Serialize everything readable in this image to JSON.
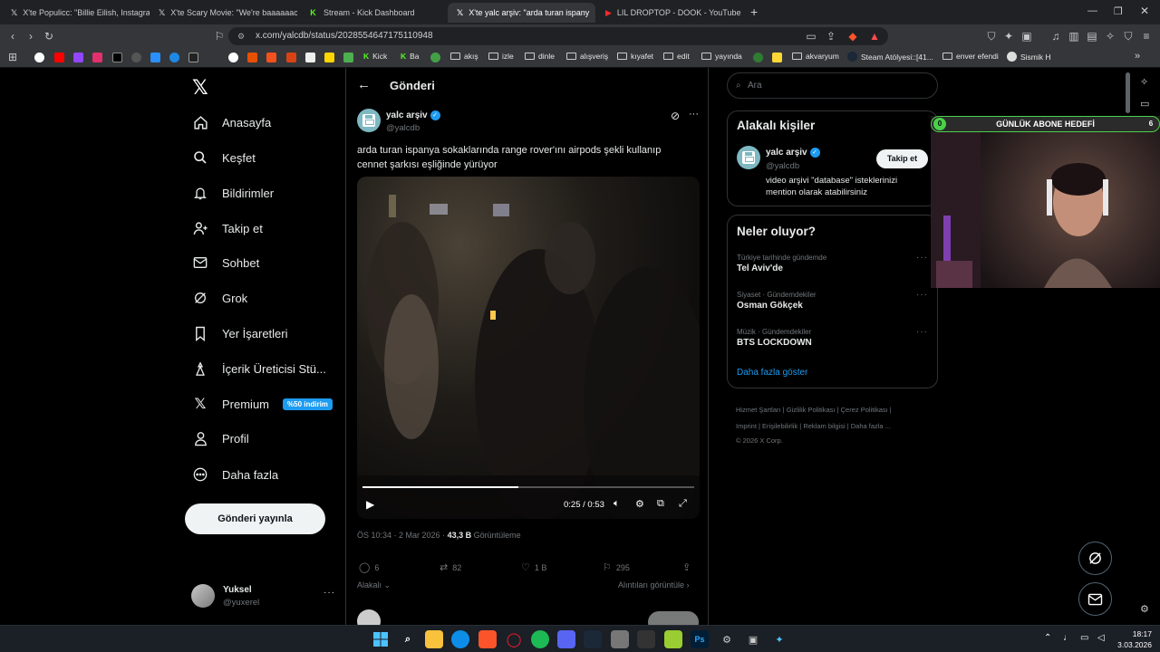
{
  "browser": {
    "tabs": [
      {
        "title": "X'te Populicc: \"Billie Eilish, Instagram'",
        "icon": "x-icon"
      },
      {
        "title": "X'te Scary Movie: \"We're baaaaaack.",
        "icon": "x-icon"
      },
      {
        "title": "Stream - Kick Dashboard",
        "icon": "kick-icon"
      },
      {
        "title": "X'te yalc arşiv: \"arda turan ispany",
        "icon": "x-icon"
      },
      {
        "title": "LIL DROPTOP - DOOK - YouTube",
        "icon": "youtube-icon"
      }
    ],
    "new_tab": "+",
    "url": "x.com/yalcdb/status/2028554647175110948",
    "bookmarks": [
      "Kick",
      "Ba",
      "akış",
      "izle",
      "dinle",
      "alışveriş",
      "kıyafet",
      "edit",
      "yayında",
      "akvaryum",
      "Steam Atölyesi::[41...",
      "enver efendi",
      "Sismik H"
    ]
  },
  "nav": {
    "items": [
      {
        "label": "Anasayfa",
        "icon": "home-icon"
      },
      {
        "label": "Keşfet",
        "icon": "search-icon"
      },
      {
        "label": "Bildirimler",
        "icon": "bell-icon"
      },
      {
        "label": "Takip et",
        "icon": "follow-icon"
      },
      {
        "label": "Sohbet",
        "icon": "mail-icon"
      },
      {
        "label": "Grok",
        "icon": "grok-icon"
      },
      {
        "label": "Yer İşaretleri",
        "icon": "bookmark-icon"
      },
      {
        "label": "İçerik Üreticisi Stü...",
        "icon": "creator-icon"
      },
      {
        "label": "Premium",
        "icon": "x-logo-icon"
      },
      {
        "label": "Profil",
        "icon": "profile-icon"
      },
      {
        "label": "Daha fazla",
        "icon": "more-icon"
      }
    ],
    "premium_badge": "%50 indirim",
    "post_button": "Gönderi yayınla",
    "account": {
      "name": "Yuksel",
      "handle": "@yuxerel"
    }
  },
  "post": {
    "header": "Gönderi",
    "author_name": "yalc arşiv",
    "author_handle": "@yalcdb",
    "text_line1": "arda turan ispanya sokaklarında range rover'ını airpods şekli kullanıp",
    "text_line2": "cennet şarkısı eşliğinde yürüyor",
    "video": {
      "time": "0:25 / 0:53",
      "progress": 0.47
    },
    "meta_time": "ÖS 10:34 · 2 Mar 2026 ·",
    "views_count": "43,3 B",
    "views_label": "Görüntüleme",
    "stats": {
      "replies": "6",
      "reposts": "82",
      "likes": "1 B",
      "bookmarks": "295"
    },
    "related_label": "Alakalı",
    "quotes_label": "Alıntıları görüntüle"
  },
  "sidebar": {
    "search_placeholder": "Ara",
    "people_title": "Alakalı kişiler",
    "person": {
      "name": "yalc arşiv",
      "handle": "@yalcdb",
      "bio": "video arşivi \"database\" isteklerinizi mention olarak atabilirsiniz",
      "follow": "Takip et"
    },
    "trends_title": "Neler oluyor?",
    "trends": [
      {
        "category": "Türkiye tarihinde gündemde",
        "name": "Tel Aviv'de"
      },
      {
        "category": "Siyaset · Gündemdekiler",
        "name": "Osman Gökçek"
      },
      {
        "category": "Müzik · Gündemdekiler",
        "name": "BTS LOCKDOWN"
      }
    ],
    "show_more": "Daha fazla göster",
    "footer": {
      "l1": "Hizmet Şartları",
      "l2": "Gizlilik Politikası",
      "l3": "Çerez Politikası",
      "l4": "Imprint",
      "l5": "Erişilebilirlik",
      "l6": "Reklam bilgisi",
      "l7": "Daha fazla ...",
      "copyright": "© 2026 X Corp."
    }
  },
  "overlay": {
    "goal_label": "GÜNLÜK ABONE HEDEFİ",
    "goal_current": "0",
    "goal_target": "6"
  },
  "taskbar": {
    "time": "18:17",
    "date": "3.03.2026"
  },
  "colors": {
    "accent": "#1d9bf0",
    "bg": "#000000",
    "goal_green": "#4ad14a"
  }
}
